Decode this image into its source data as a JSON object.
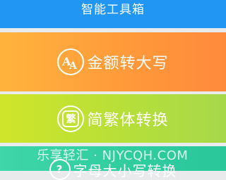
{
  "header": {
    "title": "智能工具箱"
  },
  "tools": [
    {
      "label": "金额转大写",
      "icon": "aa-letters-icon"
    },
    {
      "label": "简繁体转换",
      "icon_glyph": "繁",
      "icon": "traditional-chinese-icon"
    },
    {
      "label": "字母大小写转换",
      "icon": "question-mark-icon"
    }
  ],
  "watermark": "乐享轻汇 · NJYCQH.COM",
  "colors": {
    "header": "#2196f3",
    "card_orange": "#ff9a3a",
    "card_yellow_green": "#b7df39",
    "card_green": "#2fcc9e"
  }
}
